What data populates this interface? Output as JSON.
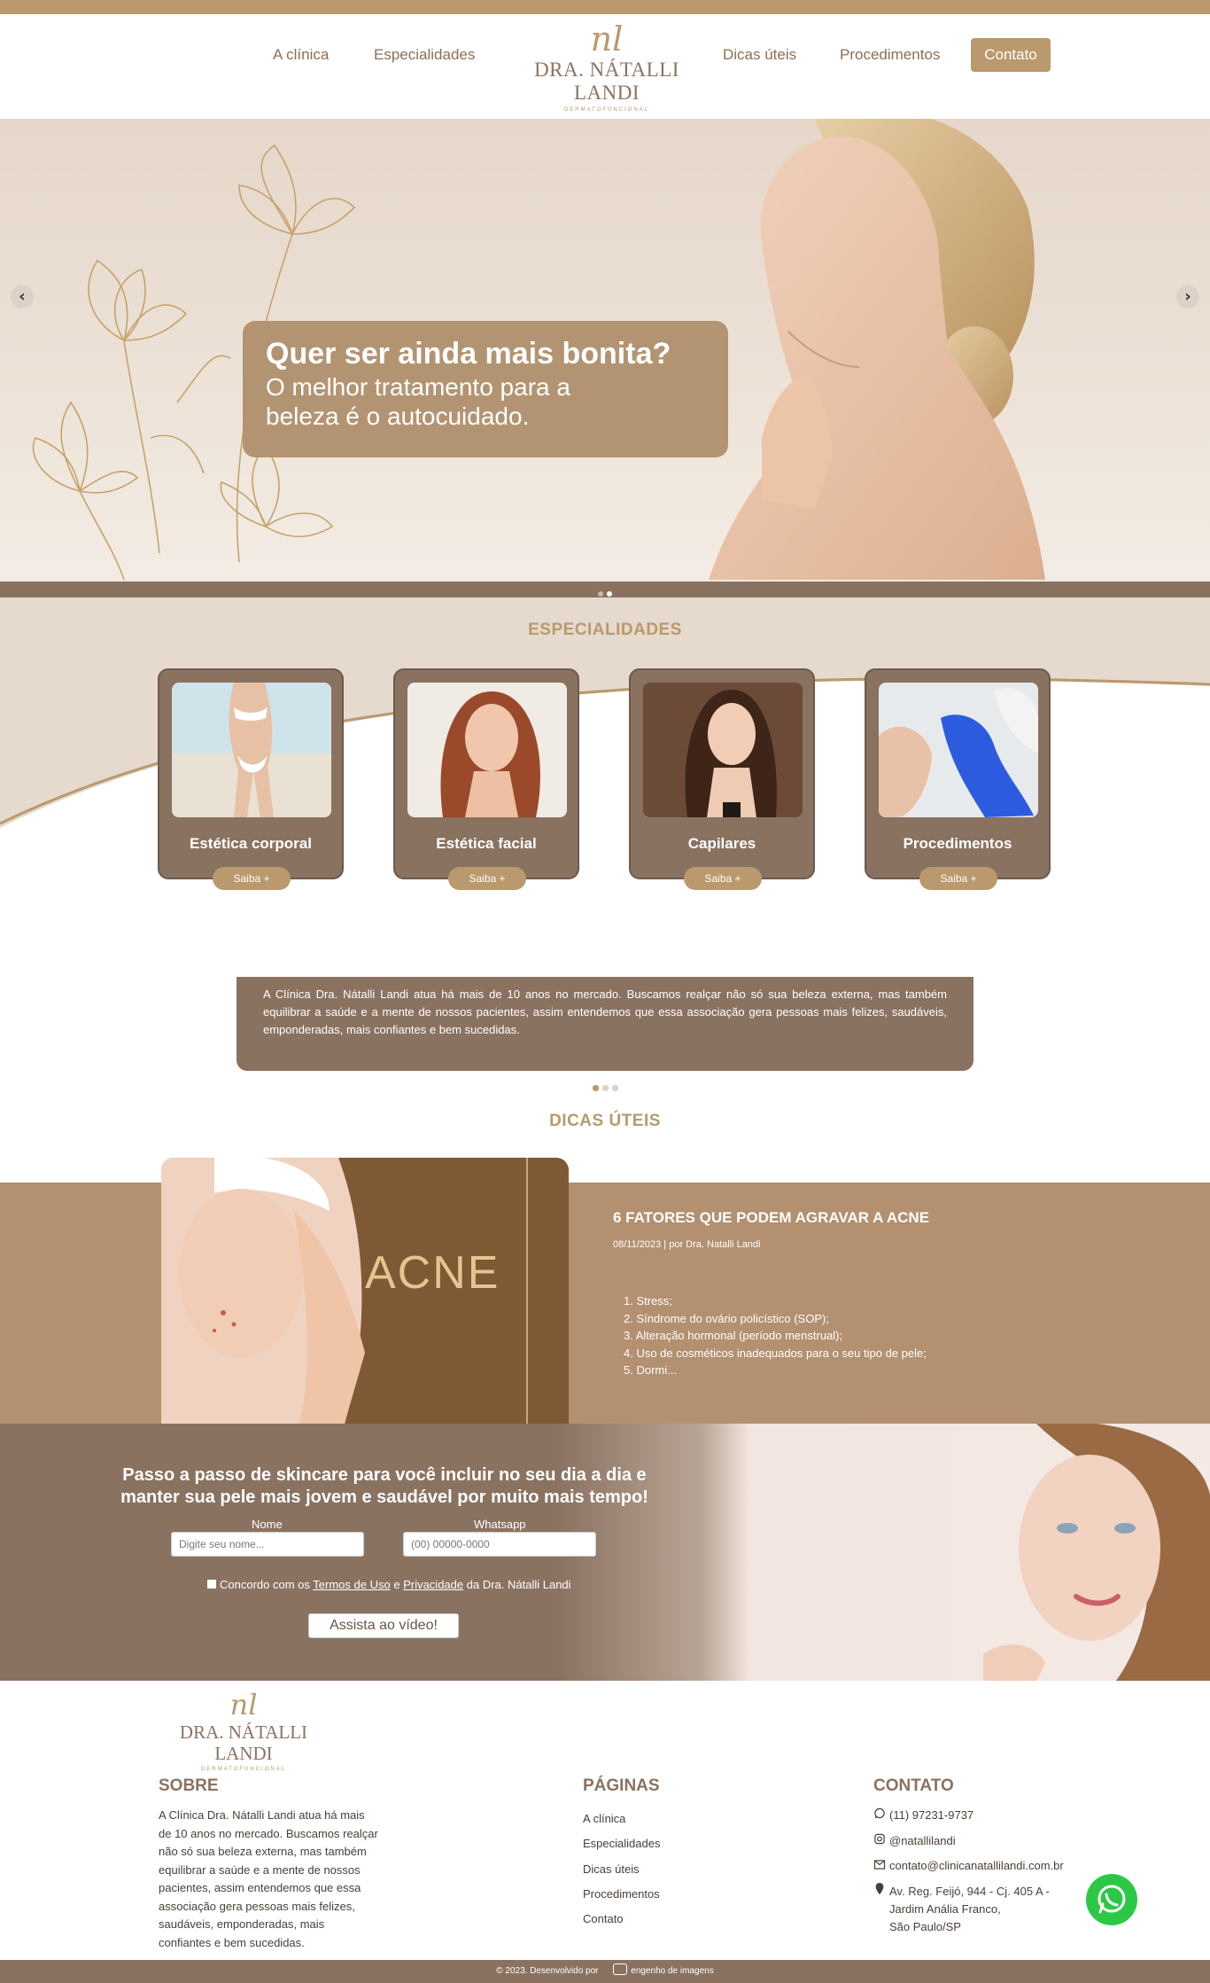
{
  "nav": {
    "left": [
      "A clínica",
      "Especialidades"
    ],
    "right": [
      "Dicas úteis",
      "Procedimentos"
    ],
    "cta": "Contato",
    "logo": {
      "monogram": "nl",
      "name": "DRA. NÁTALLI LANDI",
      "tagline": "DERMATOFUNCIONAL"
    }
  },
  "hero": {
    "headline": "Quer ser ainda mais bonita?",
    "text": "O melhor tratamento para a beleza é o autocuidado.",
    "prev": "‹",
    "next": "›"
  },
  "specialties": {
    "title": "ESPECIALIDADES",
    "cards": [
      {
        "title": "Estética corporal",
        "button": "Saiba +"
      },
      {
        "title": "Estética facial",
        "button": "Saiba +"
      },
      {
        "title": "Capilares",
        "button": "Saiba +"
      },
      {
        "title": "Procedimentos",
        "button": "Saiba +"
      }
    ]
  },
  "about": {
    "text": "A Clínica Dra. Nátalli Landi atua há mais de 10 anos no mercado. Buscamos realçar não só sua beleza externa, mas também equilibrar a saúde e a mente de nossos pacientes, assim entendemos que essa associação gera pessoas mais felizes, saudáveis, emponderadas, mais confiantes e bem sucedidas."
  },
  "tips": {
    "title": "DICAS ÚTEIS",
    "image_word": "ACNE",
    "post_title": "6 FATORES QUE PODEM AGRAVAR A ACNE",
    "post_meta": "08/11/2023 | por Dra. Natalli Landi",
    "items": [
      "1. Stress;",
      "2. Síndrome do ovário policístico (SOP);",
      "3. Alteração hormonal (período menstrual);",
      "4. Uso de cosméticos inadequados para o seu tipo de pele;",
      "5. Dormi..."
    ]
  },
  "skincare": {
    "title": "Passo a passo de skincare para você incluir no seu dia a dia e manter sua pele mais jovem e saudável por muito mais tempo!",
    "name_label": "Nome",
    "name_placeholder": "Digite seu nome...",
    "whats_label": "Whatsapp",
    "whats_placeholder": "(00) 00000-0000",
    "agree_prefix": "Concordo com os",
    "terms": "Termos de Uso",
    "and": "e",
    "privacy": "Privacidade",
    "agree_suffix": "da Dra. Nátalli Landi",
    "button": "Assista ao vídeo!"
  },
  "footer": {
    "logo": {
      "monogram": "nl",
      "name": "DRA. NÁTALLI LANDI",
      "tagline": "DERMATOFUNCIONAL"
    },
    "about_title": "SOBRE",
    "about_text": "A Clínica Dra. Nátalli Landi atua há mais de 10 anos no mercado. Buscamos realçar não só sua beleza externa, mas também equilibrar a saúde e a mente de nossos pacientes, assim entendemos que essa associação gera pessoas mais felizes, saudáveis, emponderadas, mais confiantes e bem sucedidas.",
    "pages_title": "PÁGINAS",
    "pages": [
      "A clínica",
      "Especialidades",
      "Dicas úteis",
      "Procedimentos",
      "Contato"
    ],
    "contact_title": "CONTATO",
    "phone": "(11) 97231-9737",
    "instagram": "@natallilandi",
    "email": "contato@clinicanatallilandi.com.br",
    "address": [
      "Av. Reg. Feijó, 944 - Cj. 405 A -",
      "Jardim Anália Franco,",
      "São Paulo/SP"
    ]
  },
  "bottom": {
    "copyright": "© 2023. Desenvolvido por",
    "agency": "engenho de imagens"
  }
}
